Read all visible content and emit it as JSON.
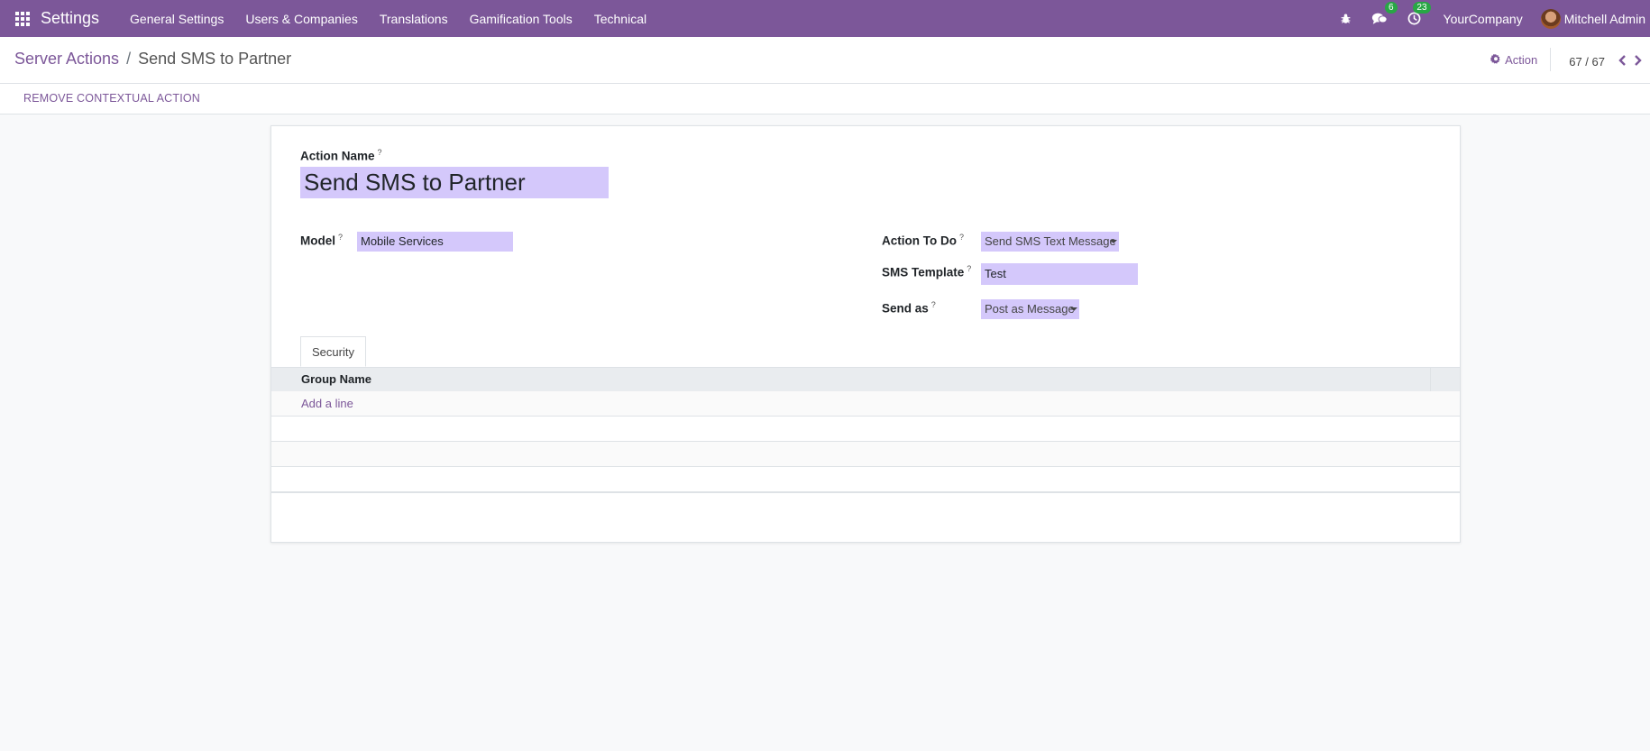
{
  "navbar": {
    "app_name": "Settings",
    "menu": [
      "General Settings",
      "Users & Companies",
      "Translations",
      "Gamification Tools",
      "Technical"
    ],
    "messages_count": "6",
    "activities_count": "23",
    "company": "YourCompany",
    "user": "Mitchell Admin",
    "color": "#7c5799"
  },
  "breadcrumb": {
    "parent": "Server Actions",
    "separator": "/",
    "current": "Send SMS to Partner"
  },
  "control": {
    "action_label": "Action",
    "pager": "67 / 67"
  },
  "buttons": {
    "remove_contextual": "REMOVE CONTEXTUAL ACTION"
  },
  "form": {
    "action_name_label": "Action Name",
    "action_name_value": "Send SMS to Partner",
    "help_mark": "?",
    "model_label": "Model",
    "model_value": "Mobile Services",
    "action_to_do_label": "Action To Do",
    "action_to_do_value": "Send SMS Text Message",
    "sms_template_label": "SMS Template",
    "sms_template_value": "Test",
    "send_as_label": "Send as",
    "send_as_value": "Post as Message",
    "field_color": "#d4c8fb"
  },
  "tabs": {
    "security": "Security"
  },
  "table": {
    "column_group_name": "Group Name",
    "add_line": "Add a line"
  }
}
